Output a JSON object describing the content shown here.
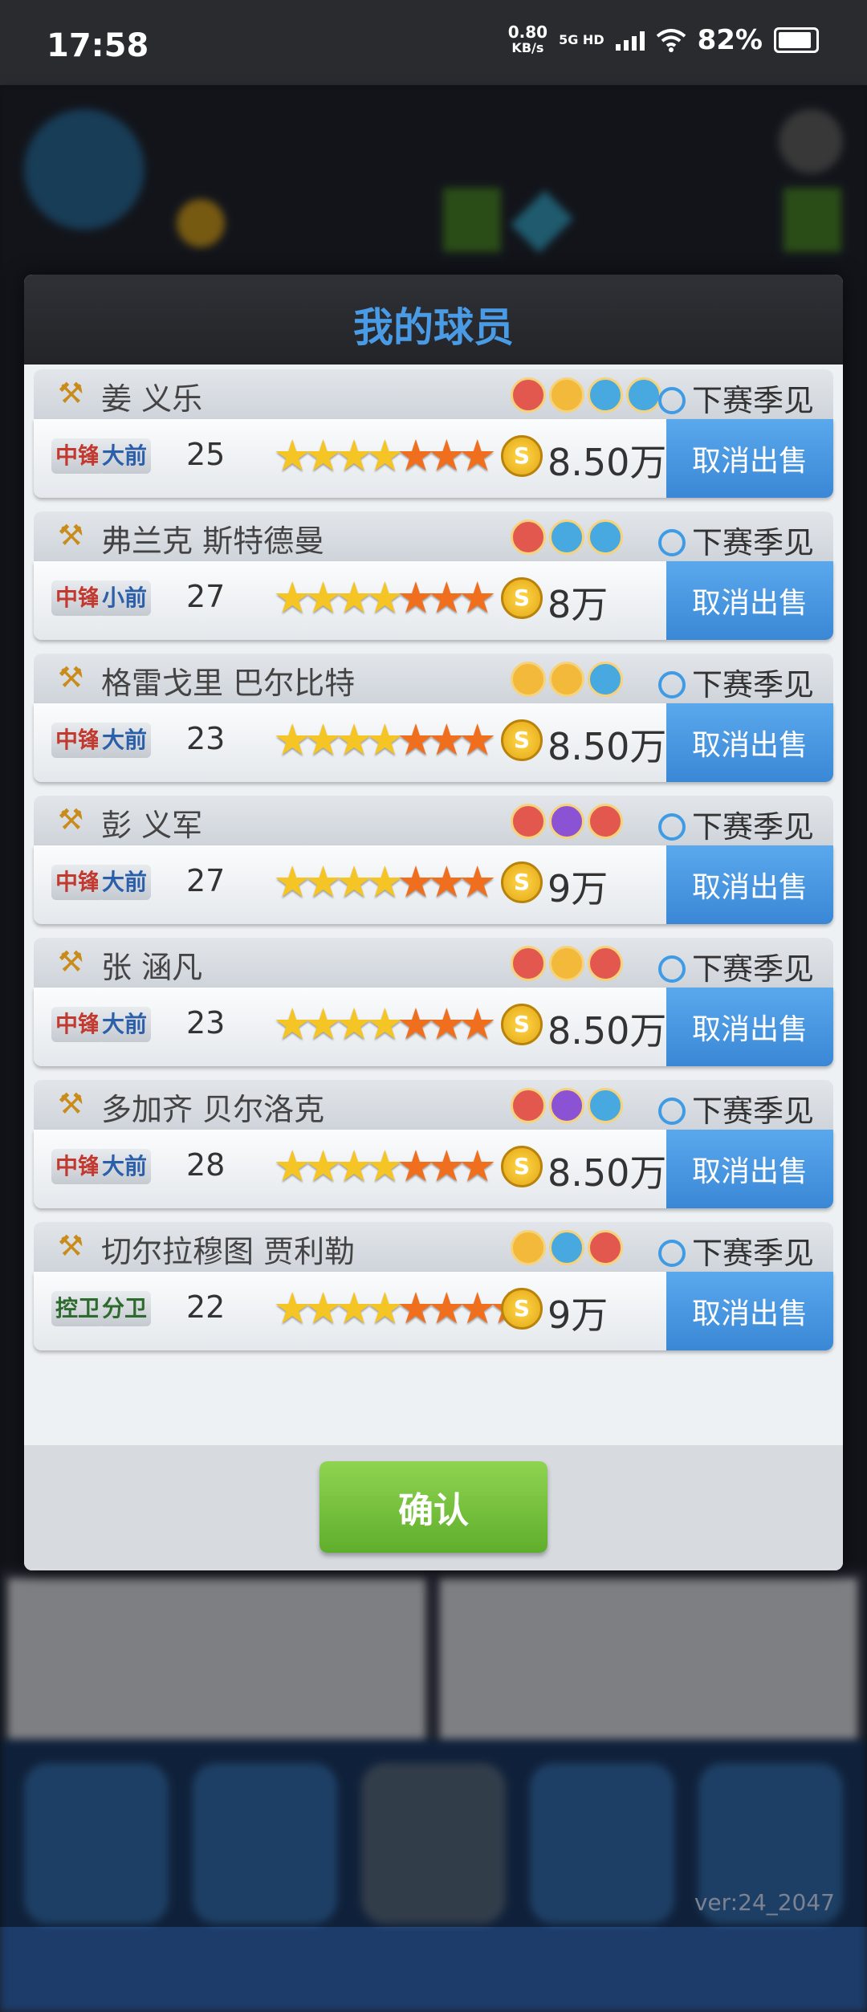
{
  "status_bar": {
    "time": "17:58",
    "speed": "0.80",
    "speed_unit": "KB/s",
    "network": "5G HD",
    "battery": "82%"
  },
  "background": {
    "version": "ver:24_2047"
  },
  "dialog": {
    "title": "我的球员",
    "confirm_label": "确认",
    "players": [
      {
        "name": "姜 义乐",
        "status": "下赛季见",
        "positions": [
          {
            "label": "中锋",
            "color": "red"
          },
          {
            "label": "大前",
            "color": "blue"
          }
        ],
        "age": "25",
        "stars": {
          "yellow": 4,
          "orange": 3
        },
        "price": "8.50万",
        "cancel_label": "取消出售",
        "badges": [
          "red",
          "gold",
          "blue",
          "blue"
        ]
      },
      {
        "name": "弗兰克 斯特德曼",
        "status": "下赛季见",
        "positions": [
          {
            "label": "中锋",
            "color": "red"
          },
          {
            "label": "小前",
            "color": "blue"
          }
        ],
        "age": "27",
        "stars": {
          "yellow": 4,
          "orange": 3
        },
        "price": "8万",
        "cancel_label": "取消出售",
        "badges": [
          "red",
          "blue",
          "blue"
        ]
      },
      {
        "name": "格雷戈里 巴尔比特",
        "status": "下赛季见",
        "positions": [
          {
            "label": "中锋",
            "color": "red"
          },
          {
            "label": "大前",
            "color": "blue"
          }
        ],
        "age": "23",
        "stars": {
          "yellow": 4,
          "orange": 3
        },
        "price": "8.50万",
        "cancel_label": "取消出售",
        "badges": [
          "gold",
          "gold",
          "blue"
        ]
      },
      {
        "name": "彭 义军",
        "status": "下赛季见",
        "positions": [
          {
            "label": "中锋",
            "color": "red"
          },
          {
            "label": "大前",
            "color": "blue"
          }
        ],
        "age": "27",
        "stars": {
          "yellow": 4,
          "orange": 3
        },
        "price": "9万",
        "cancel_label": "取消出售",
        "badges": [
          "red",
          "purple",
          "red"
        ]
      },
      {
        "name": "张 涵凡",
        "status": "下赛季见",
        "positions": [
          {
            "label": "中锋",
            "color": "red"
          },
          {
            "label": "大前",
            "color": "blue"
          }
        ],
        "age": "23",
        "stars": {
          "yellow": 4,
          "orange": 3
        },
        "price": "8.50万",
        "cancel_label": "取消出售",
        "badges": [
          "red",
          "gold",
          "red"
        ]
      },
      {
        "name": "多加齐 贝尔洛克",
        "status": "下赛季见",
        "positions": [
          {
            "label": "中锋",
            "color": "red"
          },
          {
            "label": "大前",
            "color": "blue"
          }
        ],
        "age": "28",
        "stars": {
          "yellow": 4,
          "orange": 3
        },
        "price": "8.50万",
        "cancel_label": "取消出售",
        "badges": [
          "red",
          "purple",
          "blue"
        ]
      },
      {
        "name": "切尔拉穆图 贾利勒",
        "status": "下赛季见",
        "positions": [
          {
            "label": "控卫",
            "color": "green"
          },
          {
            "label": "分卫",
            "color": "green"
          }
        ],
        "age": "22",
        "stars": {
          "yellow": 4,
          "orange": 4
        },
        "price": "9万",
        "cancel_label": "取消出售",
        "badges": [
          "gold",
          "blue",
          "red"
        ]
      }
    ]
  }
}
